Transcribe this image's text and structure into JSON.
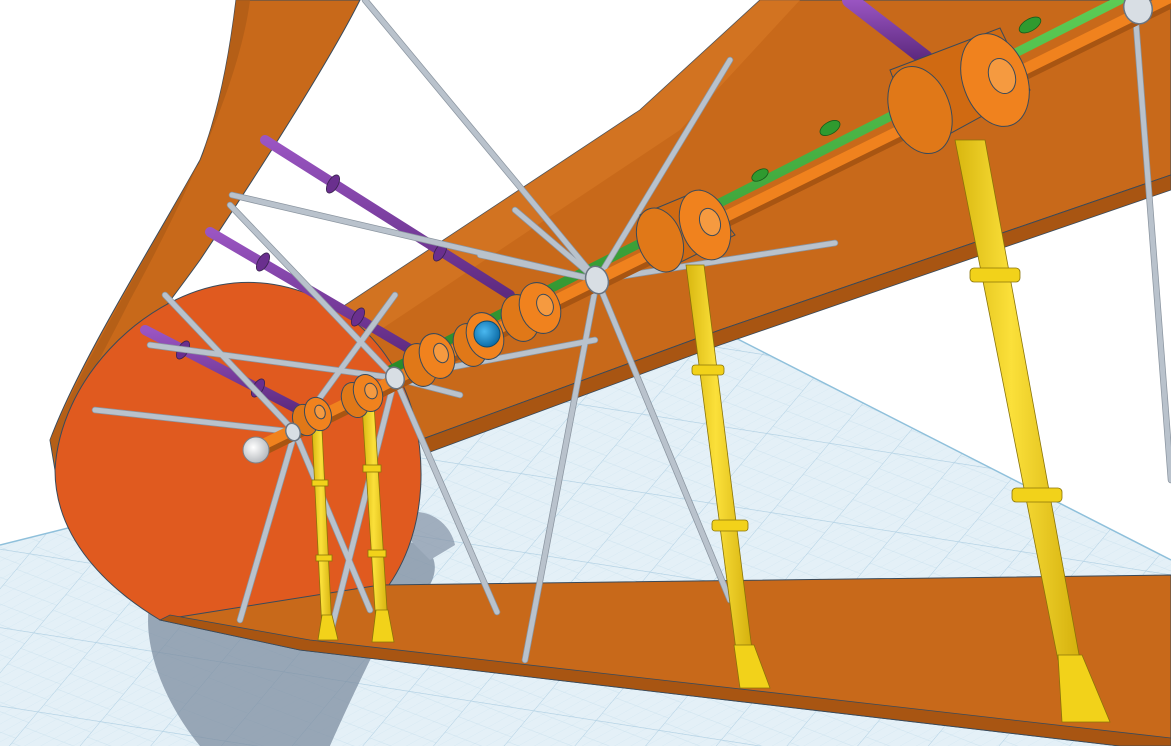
{
  "scene": {
    "description_label": "",
    "colors": {
      "frame_orange": "#c8691a",
      "frame_orange_dark": "#a85512",
      "disc_red": "#e05a1f",
      "hub_orange": "#f0821e",
      "hub_orange_dark": "#d06a12",
      "rod_purple": "#7a3a9e",
      "rod_green": "#3aa83a",
      "post_yellow": "#f2d21a",
      "post_yellow_dark": "#c9a90f",
      "spoke_gray": "#b9c2cc",
      "ball_blue": "#1e8fd0",
      "ball_white": "#eeeeee",
      "grid_bg": "#dcecf5",
      "grid_line": "#b7d4e6",
      "shadow": "#8896a8",
      "outline": "#3a4a5a"
    },
    "icons": {
      "workplane": "grid-workplane-icon",
      "shadow": "shadow-shape-icon"
    }
  }
}
